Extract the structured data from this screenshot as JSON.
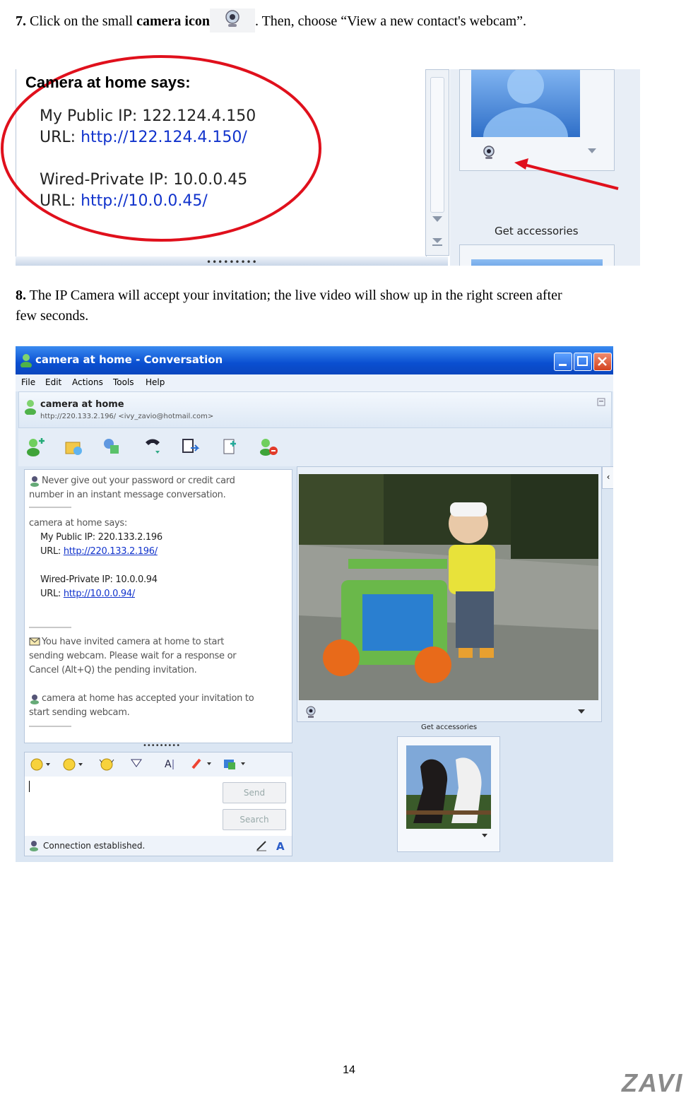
{
  "step7": {
    "num": "7.",
    "text_a": "Click on the small",
    "bold": "camera icon",
    "text_b": ". Then, choose “View a new contact's webcam”."
  },
  "shot1": {
    "heading": "Camera at home says:",
    "public_ip": "My Public IP: 122.124.4.150",
    "url_label": "URL: ",
    "public_url": "http://122.124.4.150/",
    "private_ip": "Wired-Private IP: 10.0.0.45",
    "private_url": "http://10.0.0.45/",
    "get_accessories": "Get accessories",
    "dots": "•••••••••",
    "colors": {
      "circle": "#e0101c",
      "arrow": "#e0101c"
    }
  },
  "step8": {
    "num": "8.",
    "line1": "The IP Camera will accept your invitation; the live video will show up in the right screen after",
    "line2": "few seconds."
  },
  "shot2": {
    "window_title": "camera at home - Conversation",
    "menu": [
      "File",
      "Edit",
      "Actions",
      "Tools",
      "Help"
    ],
    "contact_name": "camera at home",
    "contact_info": "http://220.133.2.196/ <ivy_zavio@hotmail.com>",
    "msg_warning": [
      "Never give out your password or credit card",
      "number in an instant message conversation."
    ],
    "msg_says": "camera at home says:",
    "msg_public_ip": "My Public IP: 220.133.2.196",
    "msg_url_label": "URL: ",
    "msg_public_url": "http://220.133.2.196/",
    "msg_private_ip": "Wired-Private IP: 10.0.0.94",
    "msg_private_url": "http://10.0.0.94/",
    "msg_invite": [
      "You have invited camera at home to start",
      "sending webcam. Please wait for a response or",
      "Cancel (Alt+Q) the pending invitation."
    ],
    "msg_accepted": [
      "camera at home has accepted your invitation to",
      "start sending webcam."
    ],
    "dots": "•••••••••",
    "send_button": "Send",
    "search_button": "Search",
    "status": "Connection established.",
    "get_accessories": "Get accessories",
    "collapse_glyph": "‹"
  },
  "page_number": "14",
  "logo": "ZAVI"
}
